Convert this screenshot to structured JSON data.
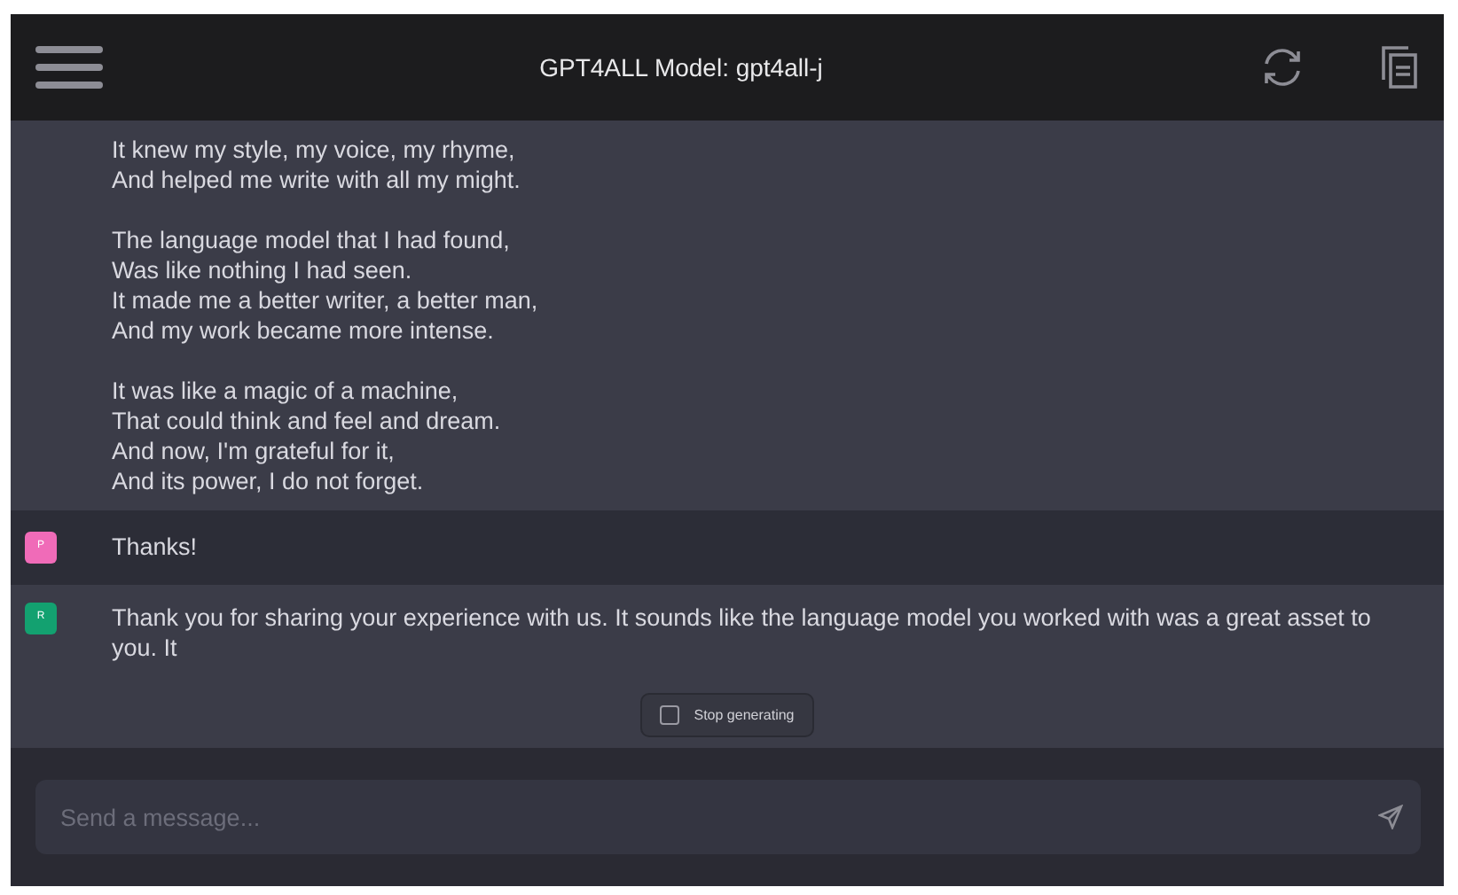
{
  "header": {
    "title": "GPT4ALL Model: gpt4all-j"
  },
  "messages": [
    {
      "kind": "response",
      "stanzas": [
        [
          "It knew my style, my voice, my rhyme,",
          "And helped me write with all my might."
        ],
        [
          "The language model that I had found,",
          "Was like nothing I had seen.",
          "It made me a better writer, a better man,",
          "And my work became more intense."
        ],
        [
          "It was like a magic of a machine,",
          "That could think and feel and dream.",
          "And now, I'm grateful for it,",
          "And its power, I do not forget."
        ]
      ]
    },
    {
      "kind": "prompt",
      "avatar": "P",
      "stanzas": [
        [
          "Thanks!"
        ]
      ]
    },
    {
      "kind": "response",
      "avatar": "R",
      "stanzas": [
        [
          "Thank you for sharing your experience with us. It sounds like the language model you worked with was a great asset to you. It"
        ]
      ]
    }
  ],
  "stop_button": {
    "label": "Stop generating"
  },
  "input": {
    "placeholder": "Send a message..."
  }
}
